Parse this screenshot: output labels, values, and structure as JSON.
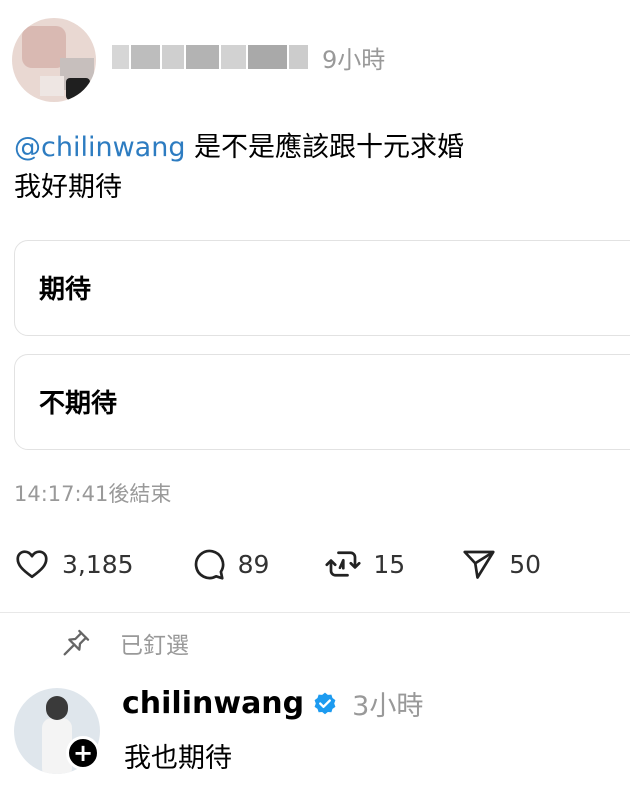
{
  "post": {
    "time": "9小時",
    "mention": "@chilinwang",
    "line1": " 是不是應該跟十元求婚",
    "line2": "我好期待"
  },
  "poll": {
    "options": [
      {
        "label": "期待"
      },
      {
        "label": "不期待"
      }
    ],
    "ends_text": "14:17:41後結束"
  },
  "actions": {
    "likes": "3,185",
    "comments": "89",
    "reposts": "15",
    "shares": "50"
  },
  "pinned_label": "已釘選",
  "reply": {
    "username": "chilinwang",
    "time": "3小時",
    "text": "我也期待"
  },
  "colors": {
    "mention": "#2d7cc1",
    "verified": "#1d9bf0",
    "muted": "#999999"
  }
}
